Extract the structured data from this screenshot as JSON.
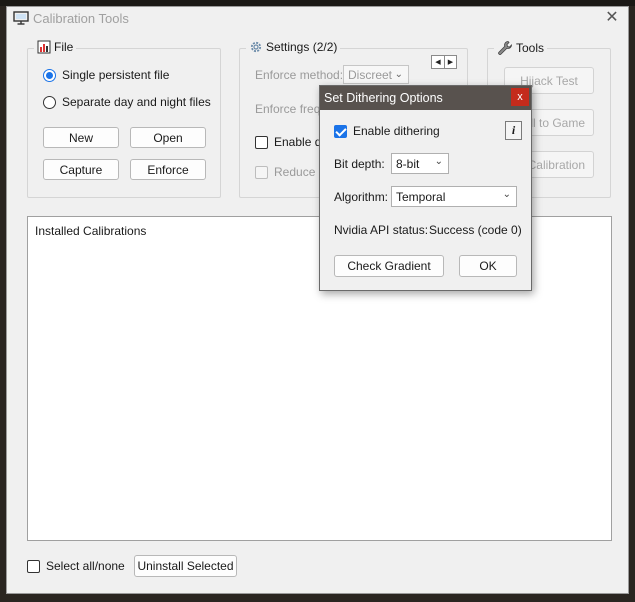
{
  "window": {
    "title": "Calibration Tools",
    "close": "✕"
  },
  "file_group": {
    "title": "File",
    "radio_single": "Single persistent file",
    "radio_separate": "Separate day and night files",
    "btn_new": "New",
    "btn_open": "Open",
    "btn_capture": "Capture",
    "btn_enforce": "Enforce"
  },
  "settings_group": {
    "title": "Settings (2/2)",
    "enforce_method_label": "Enforce method:",
    "enforce_method_value": "Discreet",
    "enforce_freq_label": "Enforce frequ",
    "enable_dith_label": "Enable dith",
    "reduce_label": "Reduce pr",
    "prev": "◀",
    "next": "▶"
  },
  "tools_group": {
    "title": "Tools",
    "btn_hijack": "Hijack Test",
    "btn_install_game": "all to Game",
    "btn_calibration": "Calibration"
  },
  "list": {
    "header": "Installed Calibrations"
  },
  "footer": {
    "select_all_label": "Select all/none",
    "uninstall_label": "Uninstall Selected"
  },
  "dialog": {
    "title": "Set Dithering Options",
    "close": "x",
    "enable_dithering_label": "Enable dithering",
    "info": "i",
    "bit_depth_label": "Bit depth:",
    "bit_depth_value": "8-bit",
    "algorithm_label": "Algorithm:",
    "algorithm_value": "Temporal",
    "api_status_label": "Nvidia API status:",
    "api_status_value": "Success (code 0)",
    "btn_check_gradient": "Check Gradient",
    "btn_ok": "OK"
  }
}
